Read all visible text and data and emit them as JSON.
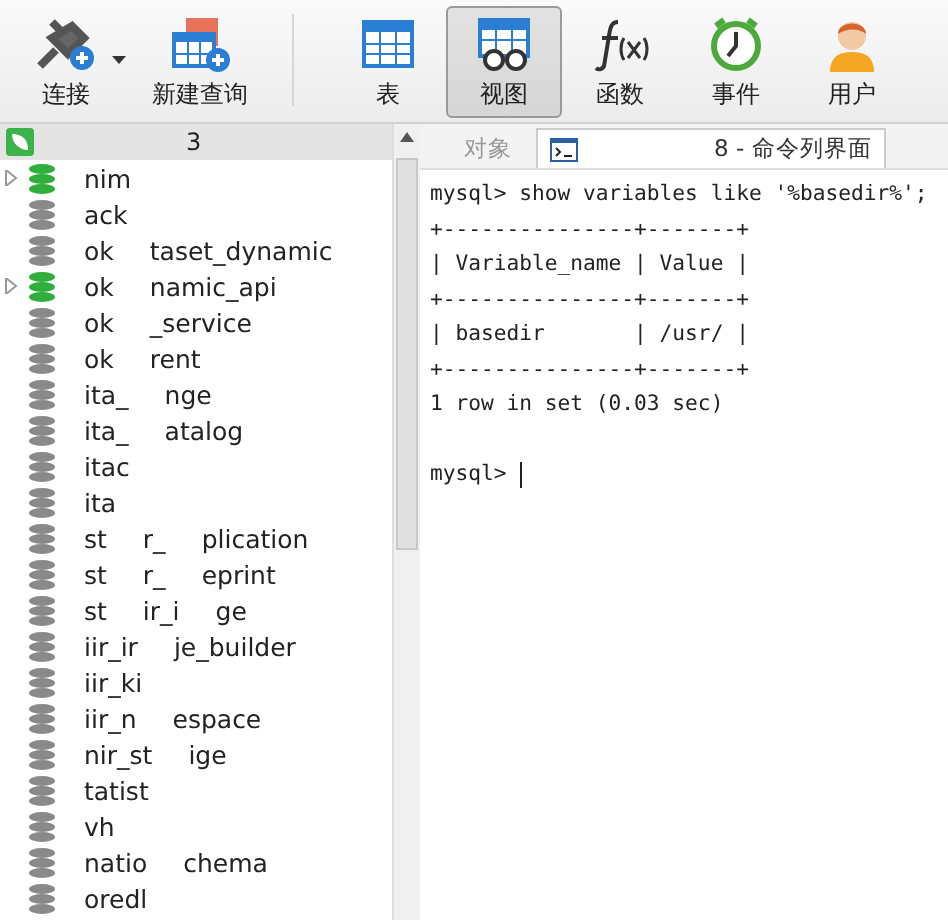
{
  "toolbar": {
    "buttons": [
      {
        "label": "连接",
        "kind": "connect",
        "selected": false
      },
      {
        "label": "新建查询",
        "kind": "query",
        "selected": false
      },
      {
        "label": "表",
        "kind": "table",
        "selected": false
      },
      {
        "label": "视图",
        "kind": "view",
        "selected": true
      },
      {
        "label": "函数",
        "kind": "function",
        "selected": false
      },
      {
        "label": "事件",
        "kind": "event",
        "selected": false
      },
      {
        "label": "用户",
        "kind": "user",
        "selected": false
      }
    ]
  },
  "sidebar": {
    "connection": {
      "label": "3"
    },
    "items": [
      {
        "parts": [
          "nim"
        ],
        "open": true,
        "expandable": true
      },
      {
        "parts": [
          "ack"
        ],
        "open": false,
        "expandable": false
      },
      {
        "parts": [
          "ok",
          "taset_dynamic"
        ],
        "open": false,
        "expandable": false
      },
      {
        "parts": [
          "ok",
          "namic_api"
        ],
        "open": true,
        "expandable": true
      },
      {
        "parts": [
          "ok",
          "_service"
        ],
        "open": false,
        "expandable": false
      },
      {
        "parts": [
          "ok",
          "rent"
        ],
        "open": false,
        "expandable": false
      },
      {
        "parts": [
          "ita_",
          "nge"
        ],
        "open": false,
        "expandable": false
      },
      {
        "parts": [
          "ita_",
          "atalog"
        ],
        "open": false,
        "expandable": false
      },
      {
        "parts": [
          "itac"
        ],
        "open": false,
        "expandable": false
      },
      {
        "parts": [
          "ita"
        ],
        "open": false,
        "expandable": false
      },
      {
        "parts": [
          "st",
          "r_",
          "plication"
        ],
        "open": false,
        "expandable": false
      },
      {
        "parts": [
          "st",
          "r_",
          "eprint"
        ],
        "open": false,
        "expandable": false
      },
      {
        "parts": [
          "st",
          "ir_i",
          "ge"
        ],
        "open": false,
        "expandable": false
      },
      {
        "parts": [
          "iir_ir",
          "je_builder"
        ],
        "open": false,
        "expandable": false
      },
      {
        "parts": [
          "iir_ki"
        ],
        "open": false,
        "expandable": false
      },
      {
        "parts": [
          "iir_n",
          "espace"
        ],
        "open": false,
        "expandable": false
      },
      {
        "parts": [
          "nir_st",
          "ige"
        ],
        "open": false,
        "expandable": false
      },
      {
        "parts": [
          "tatist"
        ],
        "open": false,
        "expandable": false
      },
      {
        "parts": [
          "vh"
        ],
        "open": false,
        "expandable": false
      },
      {
        "parts": [
          "natio",
          "chema"
        ],
        "open": false,
        "expandable": false
      },
      {
        "parts": [
          "oredl"
        ],
        "open": false,
        "expandable": false
      }
    ]
  },
  "tabs": [
    {
      "label": "对象",
      "kind": "objects",
      "selected": false
    },
    {
      "label": "8 - 命令列界面",
      "kind": "console",
      "selected": true
    }
  ],
  "console": {
    "lines": [
      "mysql> show variables like '%basedir%';",
      "+---------------+-------+",
      "| Variable_name | Value |",
      "+---------------+-------+",
      "| basedir       | /usr/ |",
      "+---------------+-------+",
      "1 row in set (0.03 sec)"
    ],
    "prompt": "mysql> ",
    "cursor": true
  }
}
